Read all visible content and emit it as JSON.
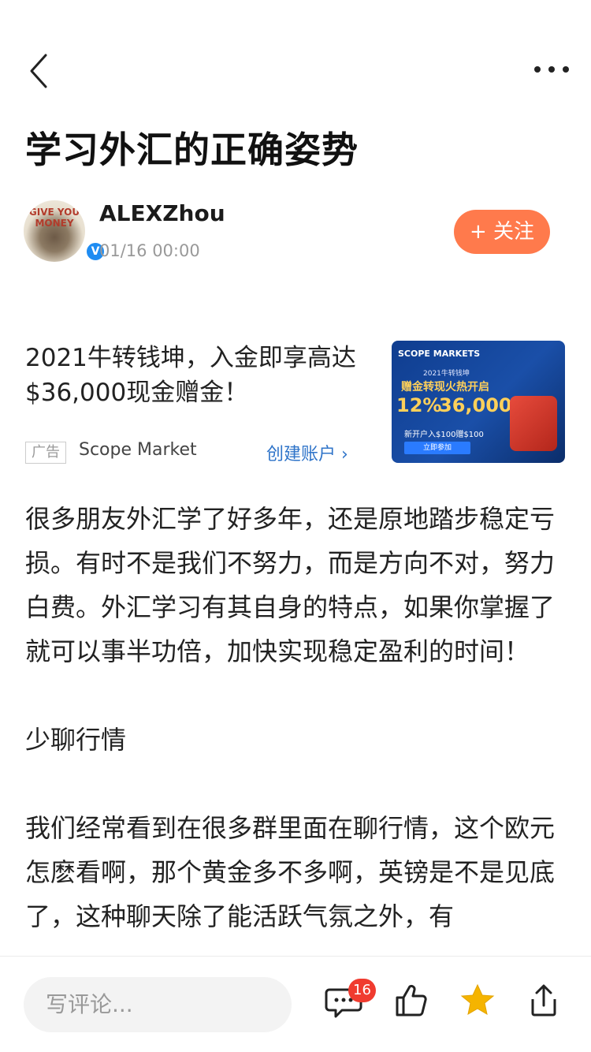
{
  "header": {
    "back_icon": "back-chevron-icon",
    "more_icon": "more-dots-icon"
  },
  "article": {
    "title": "学习外汇的正确姿势",
    "author": {
      "name": "ALEXZhou",
      "time": "01/16 00:00",
      "avatar_text": "GIVE YOU MONEY",
      "verified_mark": "V",
      "follow_label": "+ 关注"
    },
    "ad": {
      "title": "2021牛转钱坤，入金即享高达$36,000现金赠金！",
      "badge": "广告",
      "source": "Scope Market",
      "cta": "创建账户 ›",
      "image_texts": {
        "brand": "SCOPE MARKETS",
        "sub": "2021牛转钱坤",
        "headline": "赠金转现火热开启",
        "big1": "12%",
        "big2": "36,000",
        "line": "新开户入$100赠$100",
        "button": "立即参加"
      }
    },
    "paragraphs": [
      "很多朋友外汇学了好多年，还是原地踏步稳定亏损。有时不是我们不努力，而是方向不对，努力白费。外汇学习有其自身的特点，如果你掌握了就可以事半功倍，加快实现稳定盈利的时间！",
      "少聊行情",
      "我们经常看到在很多群里面在聊行情，这个欧元怎麽看啊，那个黄金多不多啊，英镑是不是见底了，这种聊天除了能活跃气氛之外，有"
    ]
  },
  "bottom_bar": {
    "comment_placeholder": "写评论...",
    "comment_count": "16",
    "icons": [
      "comment-icon",
      "like-icon",
      "favorite-star-icon",
      "share-icon"
    ],
    "star_color": "#f5b400"
  }
}
